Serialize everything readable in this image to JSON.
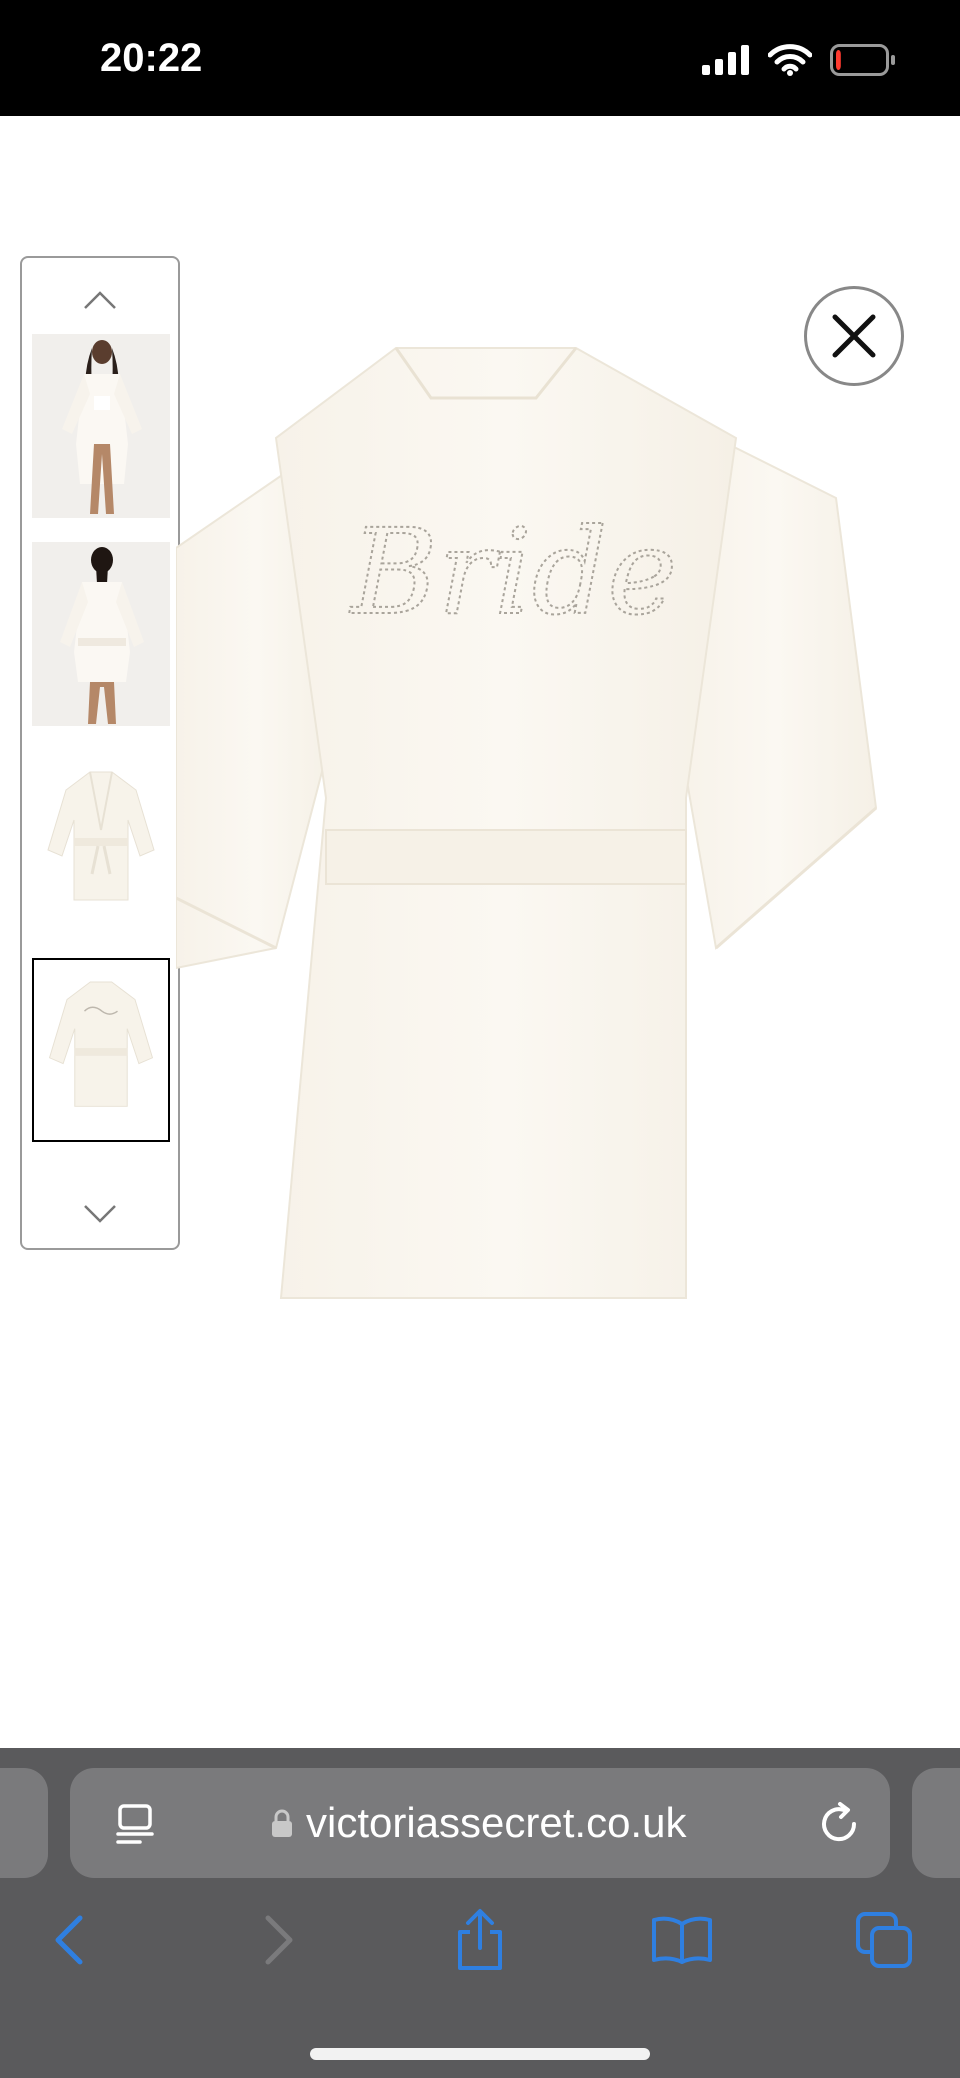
{
  "status_bar": {
    "time": "20:22",
    "battery_level": 0.1
  },
  "gallery": {
    "up_arrow_icon": "chevron-up-icon",
    "down_arrow_icon": "chevron-down-icon",
    "thumbnails": [
      {
        "subject": "model-front",
        "selected": false
      },
      {
        "subject": "model-back",
        "selected": false
      },
      {
        "subject": "robe-front",
        "selected": false
      },
      {
        "subject": "robe-back",
        "selected": true
      }
    ],
    "close_icon": "close-icon"
  },
  "main_image": {
    "subject": "robe-back",
    "embroidery_text": "Bride"
  },
  "browser": {
    "url": "victoriassecret.co.uk",
    "colors": {
      "bar": "#5a5a5c",
      "field": "#7a7a7c",
      "accent": "#2f7fe0"
    }
  }
}
